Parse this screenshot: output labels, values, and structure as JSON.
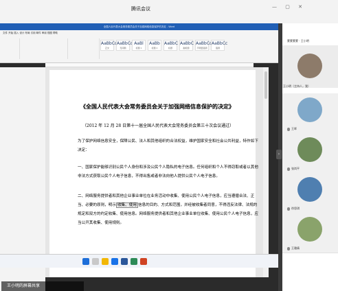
{
  "meeting": {
    "title": "腾讯会议",
    "window_controls": "—  ▢  ✕"
  },
  "word": {
    "title_bar": "全国人民代表大会常务委员会关于加强网络信息保护的决定 - Word",
    "tabs": "文件  开始  插入  设计  布局  引用  邮件  审阅  视图  帮助",
    "styles": [
      {
        "sample": "AaBbCc",
        "name": "正文"
      },
      {
        "sample": "AaBbCc",
        "name": "无间隔"
      },
      {
        "sample": "AaBl",
        "name": "标题 1"
      },
      {
        "sample": "AaBb",
        "name": "标题 2"
      },
      {
        "sample": "AaBbC",
        "name": "标题"
      },
      {
        "sample": "AaBbC",
        "name": "副标题"
      },
      {
        "sample": "AaBbCc",
        "name": "不明显强调"
      },
      {
        "sample": "AaBbCc",
        "name": "强调"
      }
    ]
  },
  "document": {
    "title": "《全国人民代表大会常务委员会关于加强网络信息保护的决定》",
    "subtitle": "（2012 年 12 月 28 日第十一届全国人民代表大会常务委员会第三十次会议通过）",
    "p1": "为了保护网络信息安全，保障公民、法人和其他组织的合法权益，维护国家安全和社会公共利益，特作如下决定：",
    "p2": "一、国家保护能够识别公民个人身份和涉及公民个人隐私的电子信息。任何组织和个人不得窃取或者以其他非法方式获取公民个人电子信息，不得出售或者非法向他人提供公民个人电子信息。",
    "p3_a": "二、网络服务提供者和其他企业事业单位在业务活动中收集、使用公民个人电子信息，应当遵循合法、正当、必要的原则，明示",
    "p3_hl": "收集、使用",
    "p3_b": "信息的目的、方式和范围，并经被收集者同意，不得违反法律、法规的规定和双方的约定收集、使用信息。网络服务提供者和其他企业事业单位收集、使用公民个人电子信息，应当公开其收集、使用规则。"
  },
  "share_label": "王小明的屏幕共享",
  "participants": {
    "first_name": "蒙蒙蒙蒙 · 王小明",
    "host_tag": "王小明（主持人，我）",
    "list": [
      {
        "name": "王晖",
        "color": "#7fa8c9"
      },
      {
        "name": "张岚平",
        "color": "#6e8b5a"
      },
      {
        "name": "徐思琪",
        "color": "#4f7fb0"
      },
      {
        "name": "王雅倩",
        "color": "#8aa36b"
      }
    ]
  }
}
